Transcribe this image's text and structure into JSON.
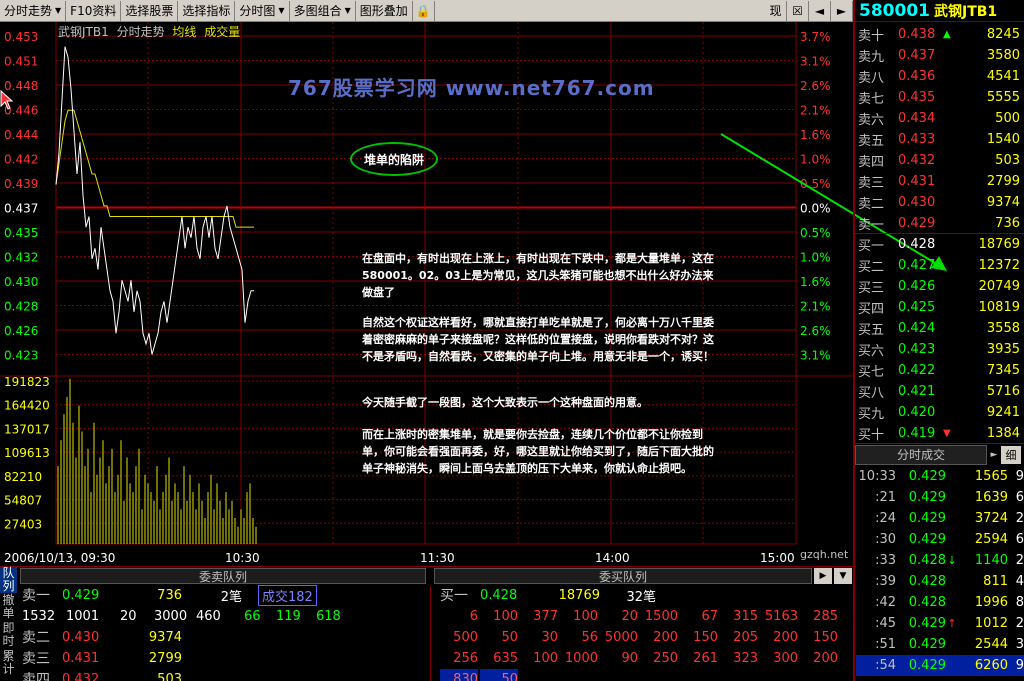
{
  "toolbar": {
    "items": [
      "分时走势",
      "F10资料",
      "选择股票",
      "选择指标",
      "分时图",
      "多图组合",
      "图形叠加"
    ],
    "right_label": "现"
  },
  "stock": {
    "code": "580001",
    "name": "武钢JTB1"
  },
  "chart_header": {
    "name": "武钢JTB1",
    "view": "分时走势",
    "avg_line": "均线",
    "volume": "成交量"
  },
  "price_axis": [
    "0.453",
    "0.451",
    "0.448",
    "0.446",
    "0.444",
    "0.442",
    "0.439",
    "0.437",
    "0.435",
    "0.432",
    "0.430",
    "0.428",
    "0.426",
    "0.423"
  ],
  "pct_axis": [
    "3.7%",
    "3.1%",
    "2.6%",
    "2.1%",
    "1.6%",
    "1.0%",
    "0.5%",
    "0.0%",
    "0.5%",
    "1.0%",
    "1.6%",
    "2.1%",
    "2.6%",
    "3.1%"
  ],
  "volume_axis": [
    "191823",
    "164420",
    "137017",
    "109613",
    "82210",
    "54807",
    "27403"
  ],
  "time_axis": [
    "2006/10/13, 09:30",
    "10:30",
    "11:30",
    "14:00",
    "15:00"
  ],
  "watermark_site": "gzqh.net",
  "watermark_banner": "767股票学习网  www.net767.com",
  "colors": {
    "background": "#000000",
    "up": "#ff3030",
    "down": "#00ff00",
    "price_line": "#ffffff",
    "avg_line": "#e0e000",
    "grid": "#800000"
  },
  "annotation": {
    "title": "堆单的陷阱",
    "paragraphs": [
      "在盘面中，有时出现在上涨上，有时出现在下跌中，都是大量堆单，这在580001。02。03上是为常见，这几头笨猪可能也想不出什么好办法来做盘了",
      "自然这个权证这样看好，哪就直接打单吃单就是了，何必离十万八千里委着密密麻麻的单子来接盘呢？这样低的位置接盘，说明你看跌对不对？这不是矛盾吗，自然看跌，又密集的单子向上堆。用意无非是一个，诱买！",
      "今天随手截了一段图，这个大致表示一个这种盘面的用意。",
      "而在上涨时的密集堆单，就是要你去捡盘，连续几个价位都不让你捡到单，你可能会看强面再委，好，哪这里就让你给买到了，随后下面大批的单子神秘消失，瞬间上面乌去盖顶的压下大单来，你就认命止损吧。"
    ]
  },
  "order_book": {
    "asks": [
      {
        "label": "卖十",
        "price": "0.438",
        "vol": "8245",
        "arrow": "up"
      },
      {
        "label": "卖九",
        "price": "0.437",
        "vol": "3580"
      },
      {
        "label": "卖八",
        "price": "0.436",
        "vol": "4541"
      },
      {
        "label": "卖七",
        "price": "0.435",
        "vol": "5555"
      },
      {
        "label": "卖六",
        "price": "0.434",
        "vol": "500"
      },
      {
        "label": "卖五",
        "price": "0.433",
        "vol": "1540"
      },
      {
        "label": "卖四",
        "price": "0.432",
        "vol": "503"
      },
      {
        "label": "卖三",
        "price": "0.431",
        "vol": "2799"
      },
      {
        "label": "卖二",
        "price": "0.430",
        "vol": "9374"
      },
      {
        "label": "卖一",
        "price": "0.429",
        "vol": "736"
      }
    ],
    "bids": [
      {
        "label": "买一",
        "price": "0.428",
        "vol": "18769"
      },
      {
        "label": "买二",
        "price": "0.427",
        "vol": "12372"
      },
      {
        "label": "买三",
        "price": "0.426",
        "vol": "20749"
      },
      {
        "label": "买四",
        "price": "0.425",
        "vol": "10819"
      },
      {
        "label": "买五",
        "price": "0.424",
        "vol": "3558"
      },
      {
        "label": "买六",
        "price": "0.423",
        "vol": "3935"
      },
      {
        "label": "买七",
        "price": "0.422",
        "vol": "7345"
      },
      {
        "label": "买八",
        "price": "0.421",
        "vol": "5716"
      },
      {
        "label": "买九",
        "price": "0.420",
        "vol": "9241"
      },
      {
        "label": "买十",
        "price": "0.419",
        "vol": "1384",
        "arrow": "down"
      }
    ]
  },
  "ticks_tab": {
    "label": "分时成交",
    "detail_btn": "细"
  },
  "ticks": [
    {
      "time": "10:33",
      "price": "0.429",
      "vol": "1565",
      "n": "9"
    },
    {
      "time": ":21",
      "price": "0.429",
      "vol": "1639",
      "n": "6"
    },
    {
      "time": ":24",
      "price": "0.429",
      "vol": "3724",
      "n": "2"
    },
    {
      "time": ":30",
      "price": "0.429",
      "vol": "2594",
      "n": "6"
    },
    {
      "time": ":33",
      "price": "0.428",
      "vol": "1140",
      "n": "2",
      "arrow": "down"
    },
    {
      "time": ":39",
      "price": "0.428",
      "vol": "811",
      "n": "4"
    },
    {
      "time": ":42",
      "price": "0.428",
      "vol": "1996",
      "n": "8"
    },
    {
      "time": ":45",
      "price": "0.429",
      "vol": "1012",
      "n": "2",
      "arrow": "up"
    },
    {
      "time": ":51",
      "price": "0.429",
      "vol": "2544",
      "n": "3"
    },
    {
      "time": ":54",
      "price": "0.429",
      "vol": "6260",
      "n": "9"
    }
  ],
  "sell_queue": {
    "header": "委卖队列",
    "row1": {
      "label": "卖一",
      "price": "0.429",
      "vol": "736",
      "count": "2笔",
      "deal": "成交182"
    },
    "row1_orders": [
      "1532",
      "1001",
      "20",
      "3000",
      "460",
      "66",
      "119",
      "618"
    ],
    "rows": [
      {
        "label": "卖二",
        "price": "0.430",
        "vol": "9374"
      },
      {
        "label": "卖三",
        "price": "0.431",
        "vol": "2799"
      },
      {
        "label": "卖四",
        "price": "0.432",
        "vol": "503"
      }
    ]
  },
  "buy_queue": {
    "header": "委买队列",
    "row1": {
      "label": "买一",
      "price": "0.428",
      "vol": "18769",
      "count": "32笔"
    },
    "orders": [
      [
        "6",
        "100",
        "377",
        "100",
        "20",
        "1500",
        "67",
        "315",
        "5163",
        "285"
      ],
      [
        "500",
        "50",
        "30",
        "56",
        "5000",
        "200",
        "150",
        "205",
        "200",
        "150"
      ],
      [
        "256",
        "635",
        "100",
        "1000",
        "90",
        "250",
        "261",
        "323",
        "300",
        "200"
      ],
      [
        "830",
        "50"
      ]
    ]
  },
  "side_tabs": [
    "队列",
    "撤单",
    "即时",
    "累计"
  ]
}
